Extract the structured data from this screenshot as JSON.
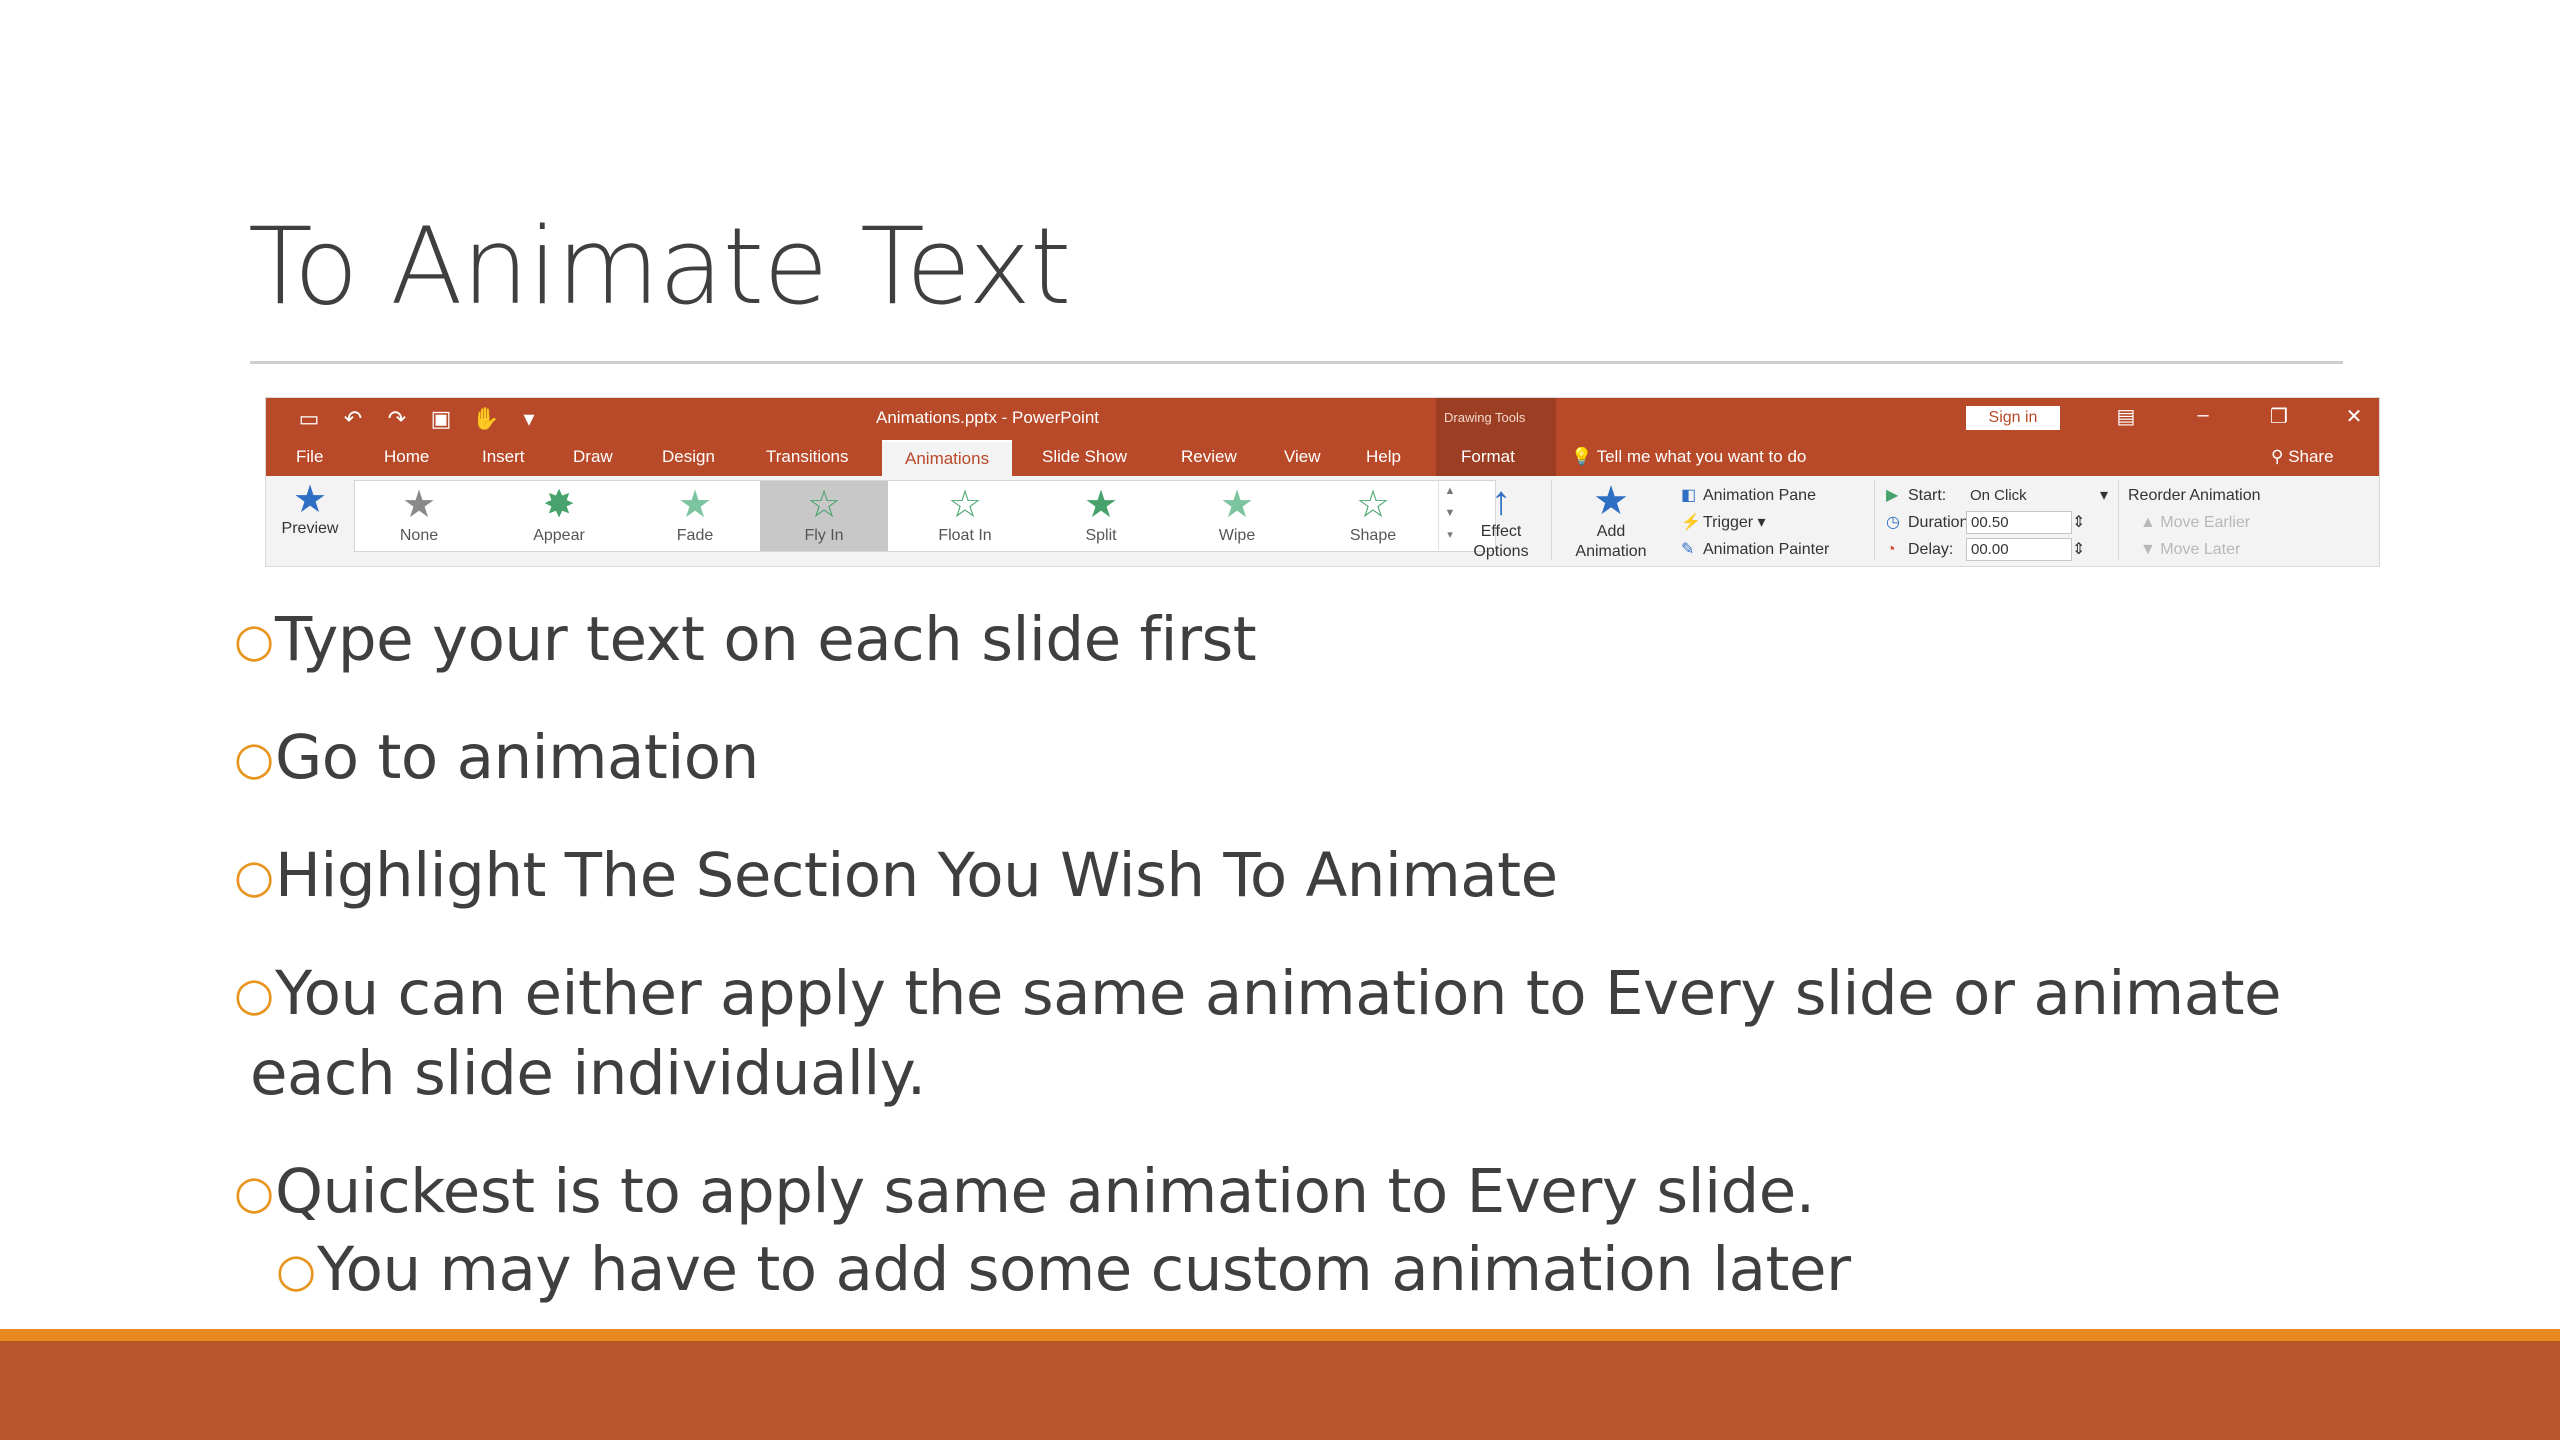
{
  "slide": {
    "title": "To Animate Text",
    "bullets": [
      {
        "text": "Type your text on each slide first"
      },
      {
        "text": "Go to animation"
      },
      {
        "text": "Highlight The Section You Wish To Animate"
      },
      {
        "text": "You can either apply the same animation to Every slide or animate",
        "cont": "each slide individually."
      },
      {
        "text": "Quickest is to apply same animation to Every slide."
      },
      {
        "text": "You may have to add some custom animation later"
      }
    ],
    "bullet_color": "#e7951e",
    "footer_colors": {
      "thin": "#e8891f",
      "thick": "#b9562b"
    }
  },
  "ribbon": {
    "doc_title": "Animations.pptx  -  PowerPoint",
    "drawing_tools": "Drawing Tools",
    "sign_in": "Sign in",
    "tabs": [
      "File",
      "Home",
      "Insert",
      "Draw",
      "Design",
      "Transitions",
      "Animations",
      "Slide Show",
      "Review",
      "View",
      "Help",
      "Format"
    ],
    "active_tab": "Animations",
    "tell_me": "Tell me what you want to do",
    "share": "Share",
    "preview": "Preview",
    "animations": [
      "None",
      "Appear",
      "Fade",
      "Fly In",
      "Float In",
      "Split",
      "Wipe",
      "Shape"
    ],
    "selected_animation": "Fly In",
    "effect_options": [
      "Effect",
      "Options"
    ],
    "add_animation": [
      "Add",
      "Animation"
    ],
    "advanced": [
      "Animation Pane",
      "Trigger",
      "Animation Painter"
    ],
    "timing": {
      "start_label": "Start:",
      "start_value": "On Click",
      "duration_label": "Duration:",
      "duration_value": "00.50",
      "delay_label": "Delay:",
      "delay_value": "00.00"
    },
    "reorder": {
      "title": "Reorder Animation",
      "earlier": "Move Earlier",
      "later": "Move Later"
    },
    "ribbon_color": "#b94a29"
  }
}
